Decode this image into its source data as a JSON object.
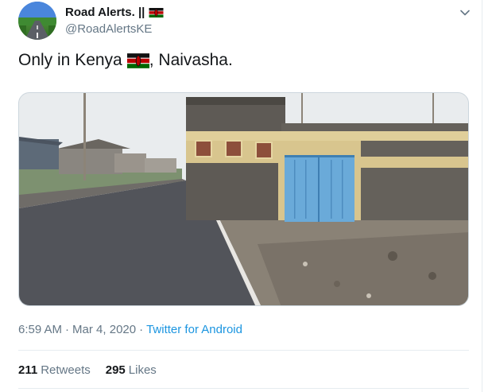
{
  "tweet": {
    "display_name": "Road Alerts. ||",
    "handle": "@RoadAlertsKE",
    "text_before_flag": "Only in Kenya",
    "text_after_flag": ", Naivasha.",
    "time": "6:59 AM",
    "separator": "·",
    "date": "Mar 4, 2020",
    "source": "Twitter for Android",
    "retweets_count": "211",
    "retweets_label": "Retweets",
    "likes_count": "295",
    "likes_label": "Likes"
  },
  "icons": {
    "more": "chevron-down-icon",
    "flag": "kenya-flag-icon"
  },
  "colors": {
    "link": "#1b95e0",
    "secondary_text": "#657786",
    "border": "#e6ecf0"
  }
}
